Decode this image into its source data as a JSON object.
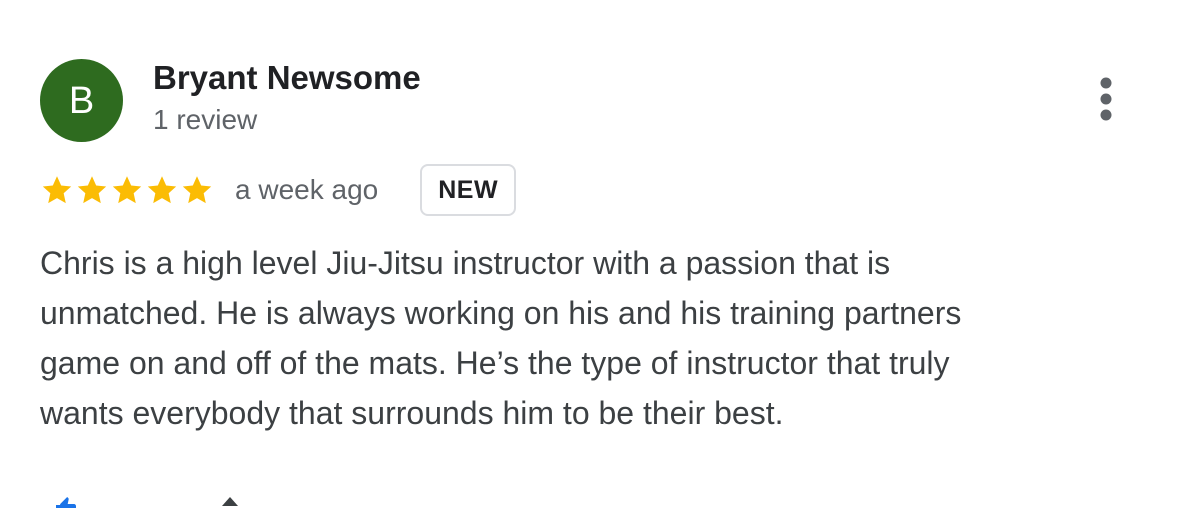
{
  "review": {
    "avatar_initial": "B",
    "avatar_color": "#2e6b1f",
    "reviewer_name": "Bryant Newsome",
    "review_count": "1 review",
    "rating": 5,
    "rating_max": 5,
    "star_color": "#fbbc04",
    "date": "a week ago",
    "badge": "NEW",
    "text_lines": [
      "Chris is a high level Jiu-Jitsu instructor with a passion that is",
      "unmatched. He is always working on his and his training partners",
      "game on and off of the mats. He’s the type of instructor that truly",
      "wants everybody that surrounds him to be their best."
    ]
  },
  "actions": {
    "more_icon": "more-vert-icon",
    "like_icon": "thumb-up-icon",
    "share_icon": "share-icon",
    "accent_color": "#1a73e8"
  }
}
